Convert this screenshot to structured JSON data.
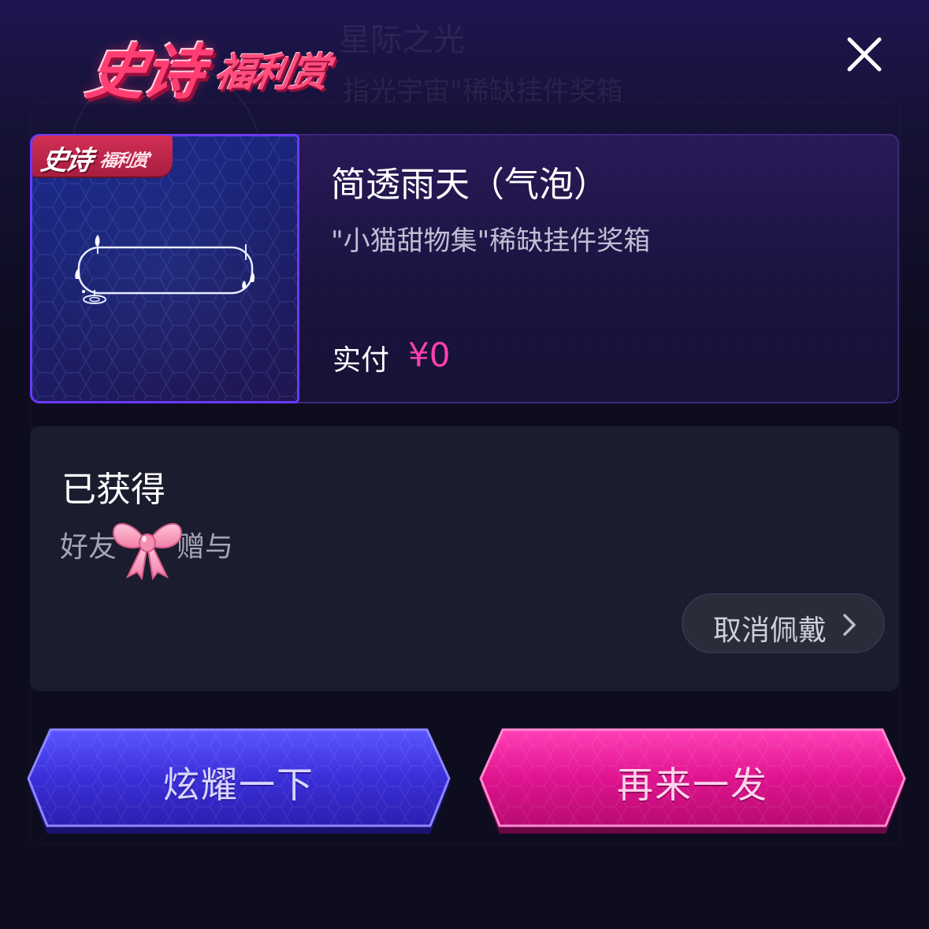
{
  "background": {
    "ghost_title": "星际之光",
    "ghost_subtitle": "指光宇宙\"稀缺挂件奖箱"
  },
  "header": {
    "logo_main": "史诗",
    "logo_sub": "福利赏",
    "close_icon": "close-icon"
  },
  "product": {
    "badge_main": "史诗",
    "badge_sub": "福利赏",
    "title": "简透雨天（气泡）",
    "subtitle": "\"小猫甜物集\"稀缺挂件奖箱",
    "paid_label": "实付",
    "paid_value": "¥0",
    "price_color": "#ff3fae",
    "item_icon": "bubble-frame-icon"
  },
  "obtained": {
    "title": "已获得",
    "gift_text": "好友",
    "gift_text_tail": "赠与",
    "bow_icon": "pink-bow-icon",
    "unwear_label": "取消佩戴",
    "chevron_icon": "chevron-right-icon"
  },
  "actions": {
    "show_off_label": "炫耀一下",
    "again_label": "再来一发",
    "show_off_color": "#3a2fd8",
    "again_color": "#e0148f"
  }
}
